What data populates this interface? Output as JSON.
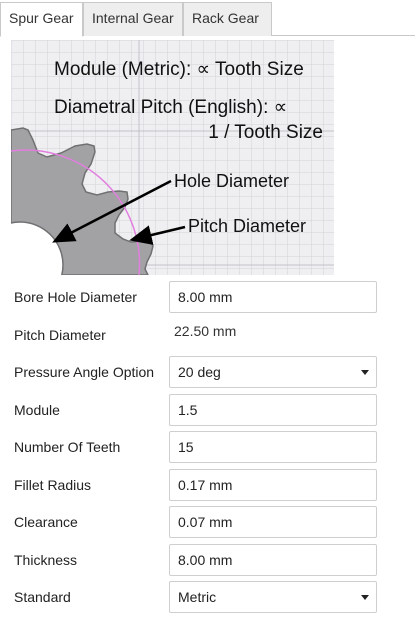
{
  "tabs": [
    {
      "label": "Spur Gear",
      "active": true
    },
    {
      "label": "Internal Gear",
      "active": false
    },
    {
      "label": "Rack Gear",
      "active": false
    }
  ],
  "diagram": {
    "line1": "Module (Metric): ∝ Tooth Size",
    "line2": "Diametral Pitch (English): ∝",
    "line3": "1 / Tooth Size",
    "hole_label": "Hole Diameter",
    "pitch_label": "Pitch Diameter",
    "colors": {
      "gear": "#a2a2a4",
      "pitch_circle": "#e27ee0",
      "grid": "#d3d3d8"
    }
  },
  "form": {
    "bore": {
      "label": "Bore Hole Diameter",
      "value": "8.00 mm"
    },
    "pitch": {
      "label": "Pitch Diameter",
      "value": "22.50 mm"
    },
    "pressure": {
      "label": "Pressure Angle Option",
      "value": "20 deg"
    },
    "module": {
      "label": "Module",
      "value": "1.5"
    },
    "teeth": {
      "label": "Number Of Teeth",
      "value": "15"
    },
    "fillet": {
      "label": "Fillet Radius",
      "value": "0.17 mm"
    },
    "clearance": {
      "label": "Clearance",
      "value": "0.07 mm"
    },
    "thickness": {
      "label": "Thickness",
      "value": "8.00 mm"
    },
    "standard": {
      "label": "Standard",
      "value": "Metric"
    }
  }
}
